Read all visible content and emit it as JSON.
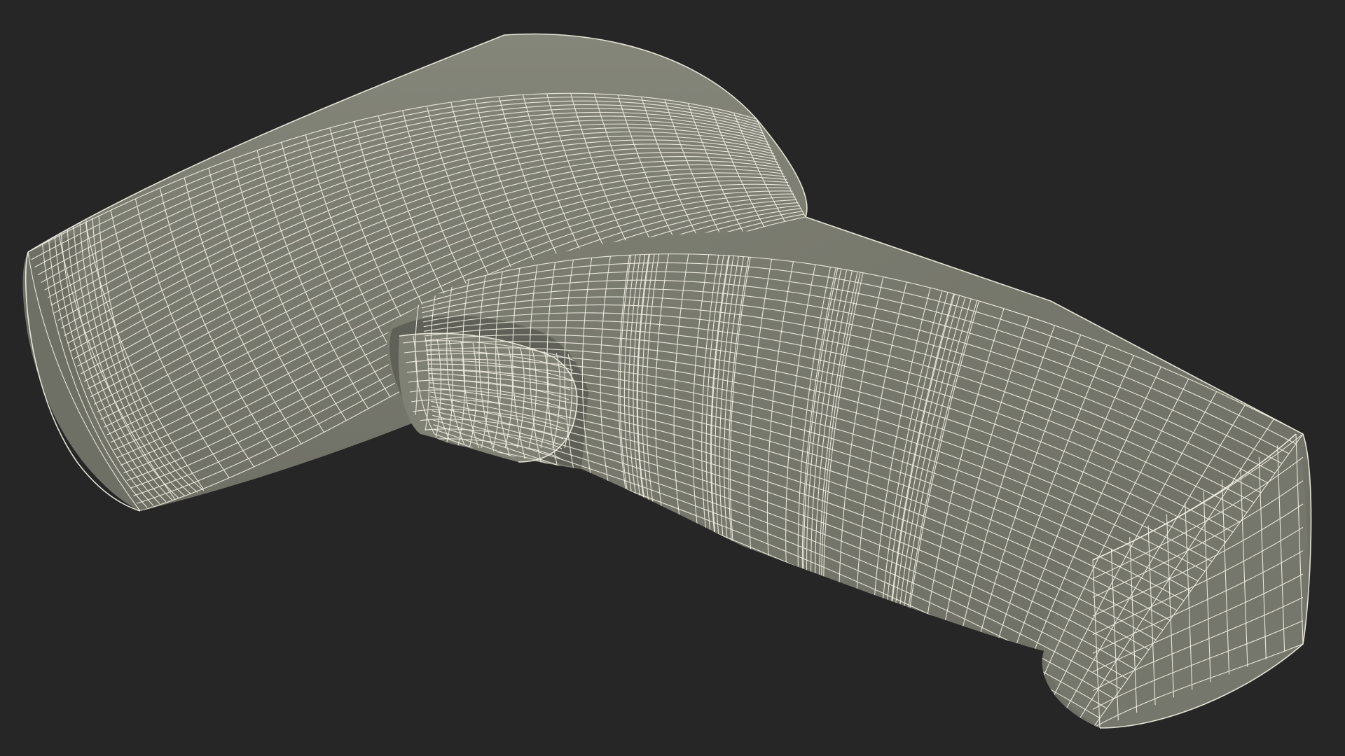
{
  "scene": {
    "background_color": "#262626",
    "subject": "wireframe-model",
    "model_fill_color": "#7c7d70",
    "model_shadow_color": "#5e5f55",
    "model_highlight_color": "#8a8b7e",
    "wire_color": "#f2f0e3"
  }
}
